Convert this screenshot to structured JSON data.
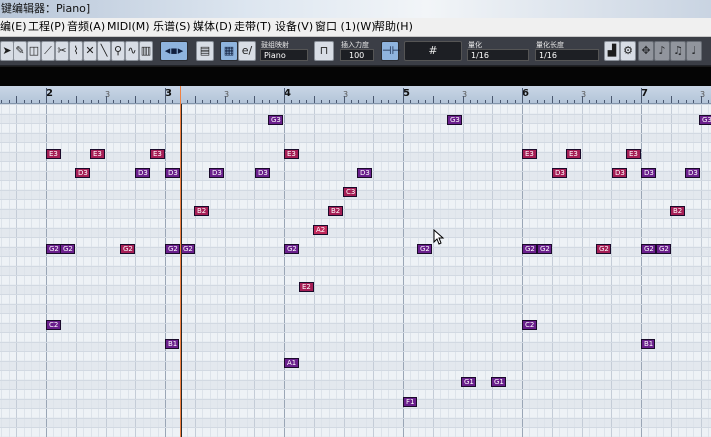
{
  "window": {
    "title": "键编辑器：Piano]"
  },
  "menu": [
    "编(E)",
    "工程(P)",
    "音频(A)",
    "MIDI(M)",
    "乐谱(S)",
    "媒体(D)",
    "走带(T)",
    "设备(V)",
    "窗口 (1)(W)",
    "帮助(H)"
  ],
  "toolbar": {
    "insert_velocity_label": "插入力度",
    "insert_velocity_value": "100",
    "drum_map_label": "鼓组映射",
    "drum_map_value": "Piano",
    "quantize_label": "量化",
    "quantize_value": "1/16",
    "length_quantize_label": "量化长度",
    "length_quantize_value": "1/16",
    "snap_symbol": "#"
  },
  "ruler": {
    "bars": [
      "2",
      "3",
      "4",
      "5",
      "6",
      "7"
    ],
    "beats": [
      "3",
      "3",
      "3",
      "3",
      "3",
      "3"
    ]
  },
  "colors": {
    "note_purple": "#6a1f8c",
    "note_red": "#c0285a",
    "note_pink": "#a51e55"
  },
  "notes": [
    {
      "label": "G3",
      "color": "purple"
    },
    {
      "label": "G3",
      "color": "purple"
    },
    {
      "label": "G3",
      "color": "purple"
    },
    {
      "label": "E3",
      "color": "pink"
    },
    {
      "label": "E3",
      "color": "pink"
    },
    {
      "label": "E3",
      "color": "pink"
    },
    {
      "label": "E3",
      "color": "pink"
    },
    {
      "label": "E3",
      "color": "pink"
    },
    {
      "label": "E3",
      "color": "pink"
    },
    {
      "label": "E3",
      "color": "pink"
    },
    {
      "label": "D3",
      "color": "pink"
    },
    {
      "label": "D3",
      "color": "purple"
    },
    {
      "label": "D3",
      "color": "purple"
    },
    {
      "label": "D3",
      "color": "purple"
    },
    {
      "label": "D3",
      "color": "purple"
    },
    {
      "label": "D3",
      "color": "purple"
    },
    {
      "label": "D3",
      "color": "pink"
    },
    {
      "label": "D3",
      "color": "pink"
    },
    {
      "label": "D3",
      "color": "purple"
    },
    {
      "label": "D3",
      "color": "purple"
    },
    {
      "label": "C3",
      "color": "pink"
    },
    {
      "label": "B2",
      "color": "pink"
    },
    {
      "label": "B2",
      "color": "pink"
    },
    {
      "label": "B2",
      "color": "pink"
    },
    {
      "label": "A2",
      "color": "red"
    },
    {
      "label": "G2",
      "color": "purple"
    },
    {
      "label": "G2",
      "color": "purple"
    },
    {
      "label": "G2",
      "color": "pink"
    },
    {
      "label": "G2",
      "color": "purple"
    },
    {
      "label": "G2",
      "color": "purple"
    },
    {
      "label": "G2",
      "color": "purple"
    },
    {
      "label": "G2",
      "color": "purple"
    },
    {
      "label": "G2",
      "color": "purple"
    },
    {
      "label": "G2",
      "color": "purple"
    },
    {
      "label": "G2",
      "color": "pink"
    },
    {
      "label": "G2",
      "color": "purple"
    },
    {
      "label": "G2",
      "color": "purple"
    },
    {
      "label": "E2",
      "color": "pink"
    },
    {
      "label": "C2",
      "color": "purple"
    },
    {
      "label": "C2",
      "color": "purple"
    },
    {
      "label": "B1",
      "color": "purple"
    },
    {
      "label": "B1",
      "color": "purple"
    },
    {
      "label": "A1",
      "color": "purple"
    },
    {
      "label": "G1",
      "color": "purple"
    },
    {
      "label": "G1",
      "color": "purple"
    },
    {
      "label": "F1",
      "color": "purple"
    }
  ]
}
